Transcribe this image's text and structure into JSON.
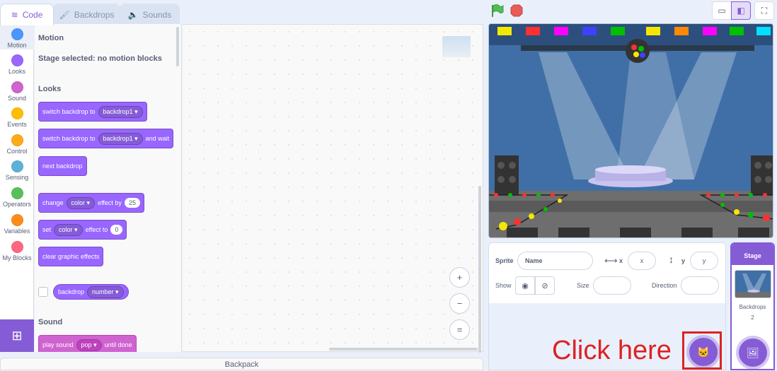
{
  "tabs": [
    {
      "label": "Code",
      "icon": "code-icon"
    },
    {
      "label": "Backdrops",
      "icon": "paintbrush-icon"
    },
    {
      "label": "Sounds",
      "icon": "speaker-icon"
    }
  ],
  "categories": [
    {
      "label": "Motion",
      "color": "#4c97ff"
    },
    {
      "label": "Looks",
      "color": "#9966ff"
    },
    {
      "label": "Sound",
      "color": "#cf63cf"
    },
    {
      "label": "Events",
      "color": "#ffbf00"
    },
    {
      "label": "Control",
      "color": "#ffab19"
    },
    {
      "label": "Sensing",
      "color": "#5cb1d6"
    },
    {
      "label": "Operators",
      "color": "#59c059"
    },
    {
      "label": "Variables",
      "color": "#ff8c1a"
    },
    {
      "label": "My Blocks",
      "color": "#ff6680"
    }
  ],
  "palette": {
    "motion_heading": "Motion",
    "motion_note": "Stage selected: no motion blocks",
    "looks_heading": "Looks",
    "switch_backdrop": {
      "text": "switch backdrop to",
      "value": "backdrop1"
    },
    "switch_backdrop_wait": {
      "text": "switch backdrop to",
      "value": "backdrop1",
      "suffix": "and wait"
    },
    "next_backdrop": "next backdrop",
    "change_effect": {
      "text": "change",
      "effect": "color",
      "mid": "effect by",
      "value": "25"
    },
    "set_effect": {
      "text": "set",
      "effect": "color",
      "mid": "effect to",
      "value": "0"
    },
    "clear_effects": "clear graphic effects",
    "backdrop_reporter": {
      "text": "backdrop",
      "value": "number"
    },
    "sound_heading": "Sound",
    "play_sound": {
      "text": "play sound",
      "value": "pop",
      "suffix": "until done"
    }
  },
  "workspace": {
    "zoom_in": "+",
    "zoom_out": "−",
    "zoom_reset": "="
  },
  "backpack": "Backpack",
  "sprite_info": {
    "sprite_label": "Sprite",
    "name_placeholder": "Name",
    "x_label": "x",
    "x_placeholder": "x",
    "y_label": "y",
    "y_placeholder": "y",
    "show_label": "Show",
    "size_label": "Size",
    "direction_label": "Direction"
  },
  "stage_selector": {
    "title": "Stage",
    "backdrops_label": "Backdrops",
    "backdrops_count": "2"
  },
  "annotation": "Click here",
  "colors": {
    "accent": "#855cd6",
    "flag": "#4cbf56",
    "stop": "#ec5959",
    "annotation": "#dd2222"
  }
}
